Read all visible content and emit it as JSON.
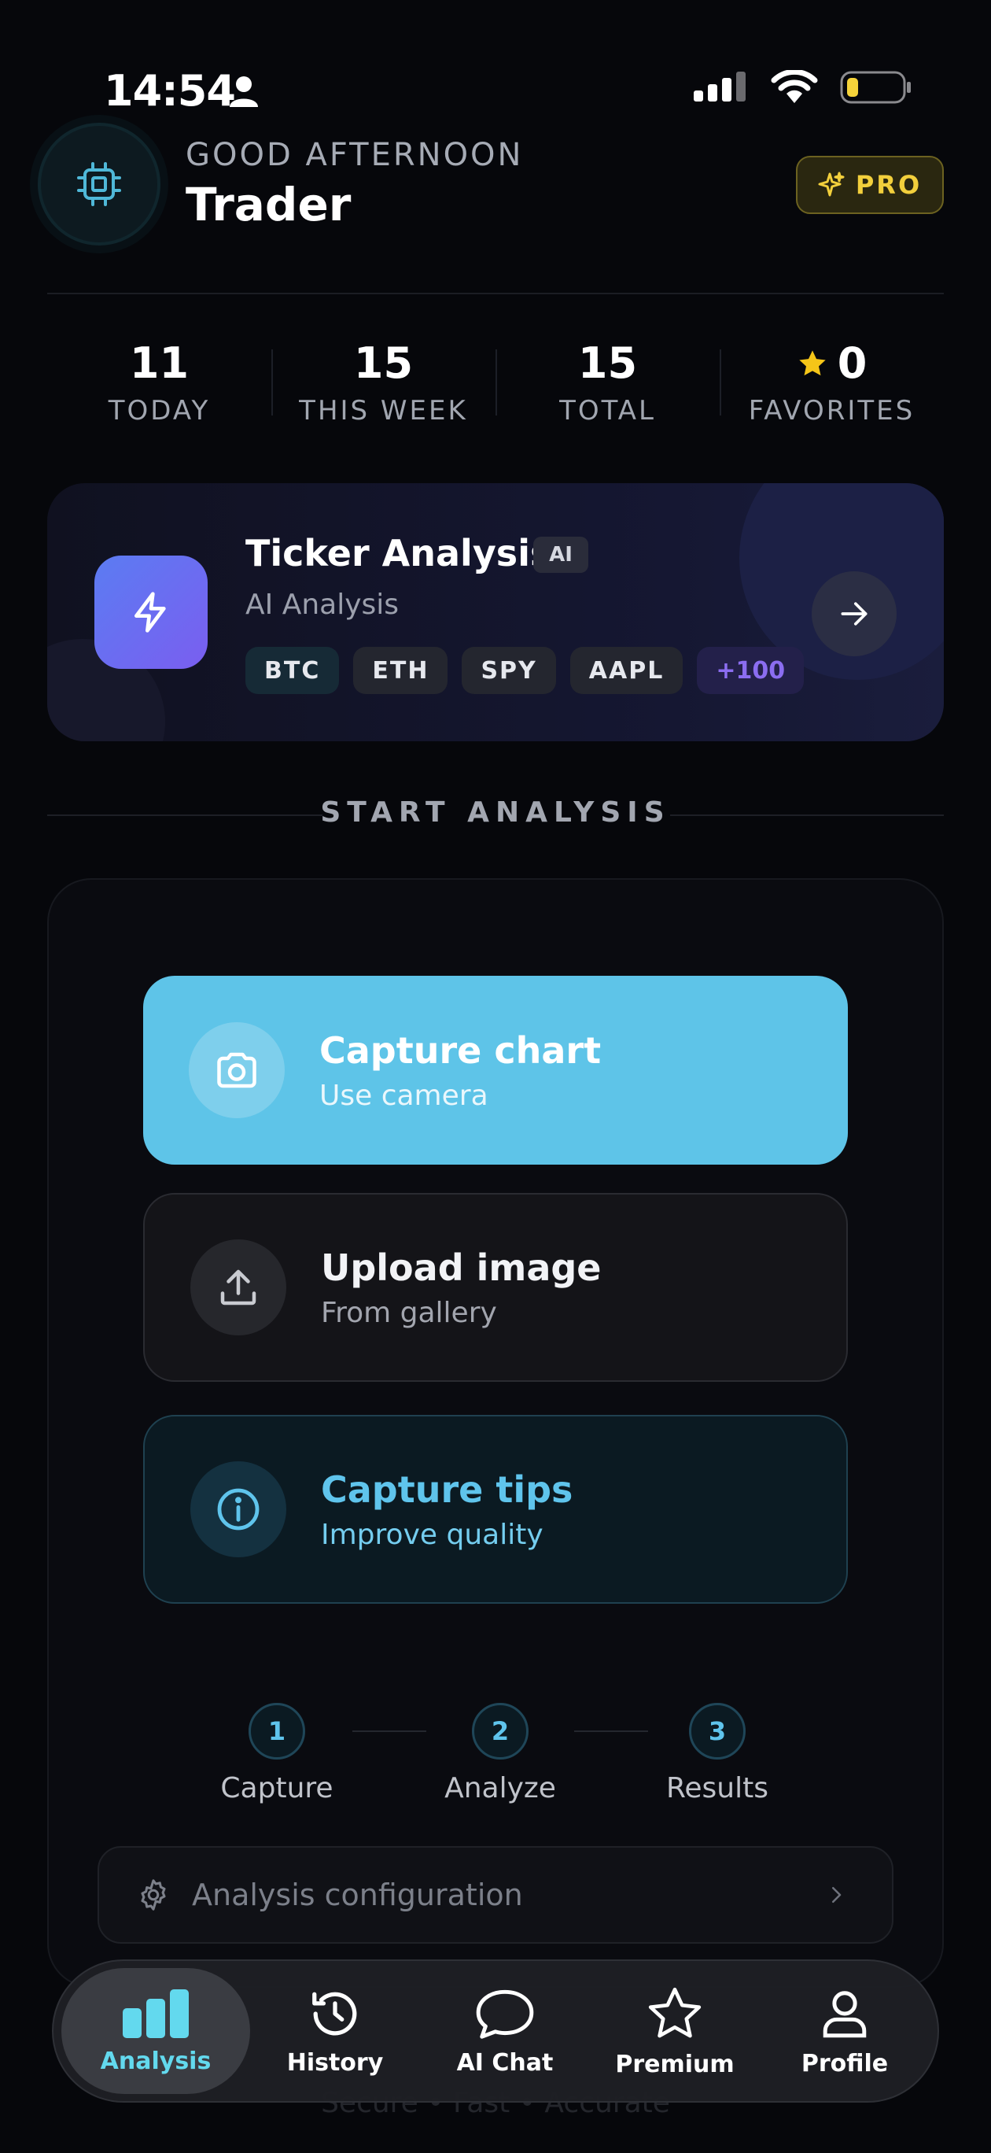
{
  "status_bar": {
    "time": "14:54"
  },
  "header": {
    "greeting": "GOOD AFTERNOON",
    "name": "Trader",
    "badge": "PRO"
  },
  "stats": [
    {
      "value": "11",
      "label": "TODAY"
    },
    {
      "value": "15",
      "label": "THIS WEEK"
    },
    {
      "value": "15",
      "label": "TOTAL"
    },
    {
      "value": "0",
      "label": "FAVORITES"
    }
  ],
  "ticker_card": {
    "title": "Ticker Analysis",
    "tag": "AI",
    "subtitle": "AI Analysis",
    "chips": [
      "BTC",
      "ETH",
      "SPY",
      "AAPL",
      "+100"
    ]
  },
  "section_title": "START ANALYSIS",
  "actions": {
    "capture": {
      "title": "Capture chart",
      "subtitle": "Use camera"
    },
    "upload": {
      "title": "Upload image",
      "subtitle": "From gallery"
    },
    "tips": {
      "title": "Capture tips",
      "subtitle": "Improve quality"
    }
  },
  "steps": [
    {
      "num": "1",
      "label": "Capture"
    },
    {
      "num": "2",
      "label": "Analyze"
    },
    {
      "num": "3",
      "label": "Results"
    }
  ],
  "config_label": "Analysis configuration",
  "footer_text": "Secure  •  Fast  •  Accurate",
  "tabs": [
    {
      "label": "Analysis",
      "icon": "bar-chart-icon"
    },
    {
      "label": "History",
      "icon": "history-icon"
    },
    {
      "label": "AI Chat",
      "icon": "chat-bubble-icon"
    },
    {
      "label": "Premium",
      "icon": "star-icon"
    },
    {
      "label": "Profile",
      "icon": "person-icon"
    }
  ],
  "colors": {
    "background": "#06070b",
    "accent_cyan": "#5ec4e8",
    "pro_gold": "#f2cf3c",
    "purple": "#7a5ef0"
  }
}
